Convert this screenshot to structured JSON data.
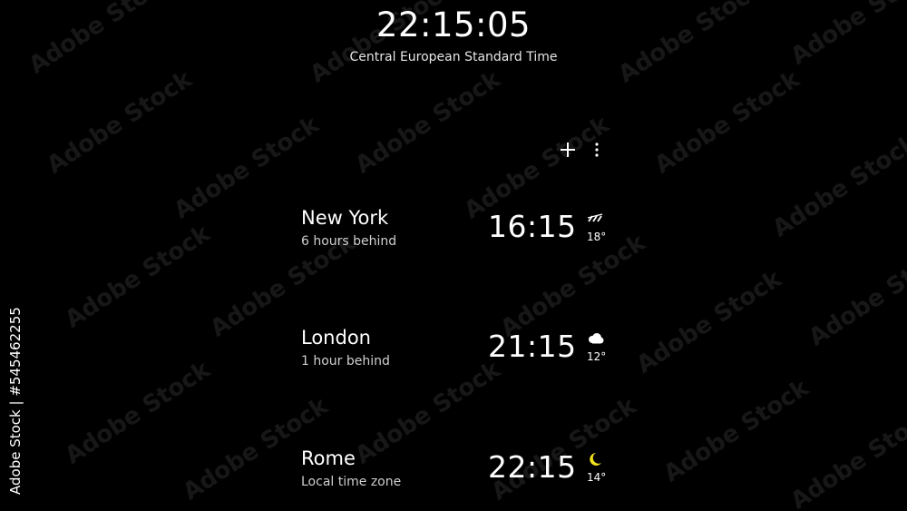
{
  "header": {
    "current_time": "22:15:05",
    "timezone": "Central European Standard Time"
  },
  "toolbar": {
    "add_icon": "plus-icon",
    "more_icon": "more-vertical-icon"
  },
  "cities": [
    {
      "name": "New York",
      "offset": "6 hours behind",
      "time": "16:15",
      "weather_icon": "rain-icon",
      "temperature": "18°"
    },
    {
      "name": "London",
      "offset": "1 hour behind",
      "time": "21:15",
      "weather_icon": "cloud-icon",
      "temperature": "12°"
    },
    {
      "name": "Rome",
      "offset": "Local time zone",
      "time": "22:15",
      "weather_icon": "moon-icon",
      "temperature": "14°"
    }
  ],
  "colors": {
    "background": "#000000",
    "text": "#ffffff",
    "secondary_text": "#cfcfcf",
    "moon": "#f2e21a"
  },
  "watermark": {
    "text": "Adobe Stock",
    "id": "Adobe Stock | #545462255"
  }
}
